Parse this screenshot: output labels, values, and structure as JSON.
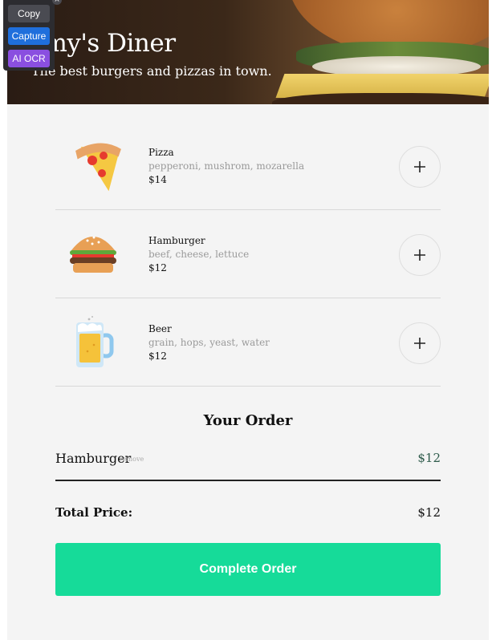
{
  "header": {
    "title": "nmy's Diner",
    "subtitle": "The best burgers and pizzas in town."
  },
  "menu": {
    "items": [
      {
        "name": "Pizza",
        "ingredients": "pepperoni, mushrom, mozarella",
        "price": "$14",
        "icon": "pizza-icon"
      },
      {
        "name": "Hamburger",
        "ingredients": "beef, cheese, lettuce",
        "price": "$12",
        "icon": "hamburger-icon"
      },
      {
        "name": "Beer",
        "ingredients": "grain, hops, yeast, water",
        "price": "$12",
        "icon": "beer-icon"
      }
    ],
    "add_symbol": "+"
  },
  "order": {
    "title": "Your Order",
    "items": [
      {
        "name": "Hamburger",
        "remove_label": "remove",
        "price": "$12"
      }
    ],
    "total_label": "Total Price:",
    "total_value": "$12",
    "complete_label": "Complete Order"
  },
  "extension": {
    "copy_label": "Copy",
    "capture_label": "Capture",
    "ocr_label": "AI OCR",
    "close_symbol": "×"
  },
  "colors": {
    "accent": "#16db99",
    "page_bg": "#f4f4f4"
  }
}
